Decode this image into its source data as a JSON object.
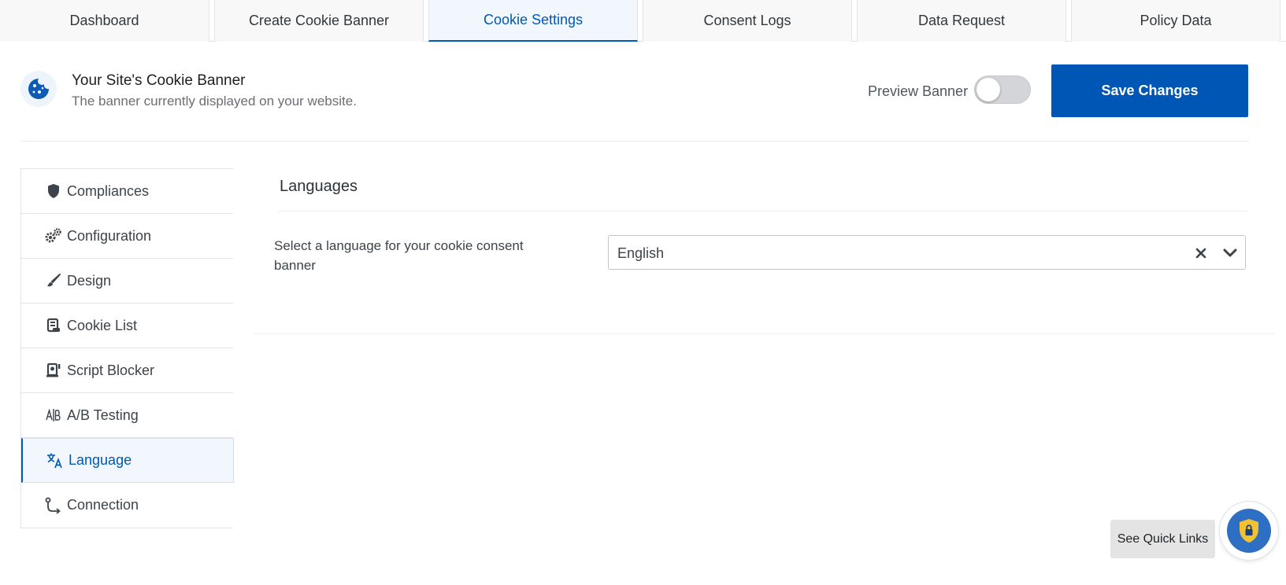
{
  "tabs": [
    {
      "label": "Dashboard"
    },
    {
      "label": "Create Cookie Banner"
    },
    {
      "label": "Cookie Settings"
    },
    {
      "label": "Consent Logs"
    },
    {
      "label": "Data Request"
    },
    {
      "label": "Policy Data"
    }
  ],
  "active_tab": "Cookie Settings",
  "header": {
    "title": "Your Site's Cookie Banner",
    "subtitle": "The banner currently displayed on your website.",
    "preview_label": "Preview Banner",
    "preview_enabled": false,
    "save_label": "Save Changes",
    "icon": "cookie-icon"
  },
  "sidebar": {
    "items": [
      {
        "label": "Compliances",
        "icon": "shield-icon"
      },
      {
        "label": "Configuration",
        "icon": "gears-icon"
      },
      {
        "label": "Design",
        "icon": "brush-icon"
      },
      {
        "label": "Cookie List",
        "icon": "scroll-icon"
      },
      {
        "label": "Script Blocker",
        "icon": "script-blocker-icon"
      },
      {
        "label": "A/B Testing",
        "icon": "ab-icon"
      },
      {
        "label": "Language",
        "icon": "translate-icon"
      },
      {
        "label": "Connection",
        "icon": "connection-icon"
      }
    ],
    "active": "Language"
  },
  "main": {
    "section_title": "Languages",
    "field_label": "Select a language for your cookie consent banner",
    "selected_language": "English"
  },
  "quick_links_label": "See Quick Links",
  "colors": {
    "accent": "#0059b2",
    "save_button": "#0056b4",
    "fab_blue": "#2e6fc3",
    "fab_shield": "#f2c230"
  }
}
